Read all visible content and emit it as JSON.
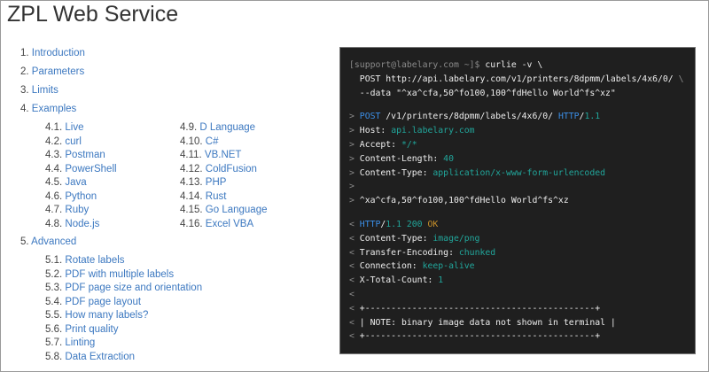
{
  "title": "ZPL Web Service",
  "toc": [
    {
      "num": "1.",
      "label": "Introduction"
    },
    {
      "num": "2.",
      "label": "Parameters"
    },
    {
      "num": "3.",
      "label": "Limits"
    },
    {
      "num": "4.",
      "label": "Examples"
    },
    {
      "num": "5.",
      "label": "Advanced"
    }
  ],
  "examples_col1": [
    {
      "num": "4.1.",
      "label": "Live"
    },
    {
      "num": "4.2.",
      "label": "curl"
    },
    {
      "num": "4.3.",
      "label": "Postman"
    },
    {
      "num": "4.4.",
      "label": "PowerShell"
    },
    {
      "num": "4.5.",
      "label": "Java"
    },
    {
      "num": "4.6.",
      "label": "Python"
    },
    {
      "num": "4.7.",
      "label": "Ruby"
    },
    {
      "num": "4.8.",
      "label": "Node.js"
    }
  ],
  "examples_col2": [
    {
      "num": "4.9.",
      "label": "D Language"
    },
    {
      "num": "4.10.",
      "label": "C#"
    },
    {
      "num": "4.11.",
      "label": "VB.NET"
    },
    {
      "num": "4.12.",
      "label": "ColdFusion"
    },
    {
      "num": "4.13.",
      "label": "PHP"
    },
    {
      "num": "4.14.",
      "label": "Rust"
    },
    {
      "num": "4.15.",
      "label": "Go Language"
    },
    {
      "num": "4.16.",
      "label": "Excel VBA"
    }
  ],
  "advanced": [
    {
      "num": "5.1.",
      "label": "Rotate labels"
    },
    {
      "num": "5.2.",
      "label": "PDF with multiple labels"
    },
    {
      "num": "5.3.",
      "label": "PDF page size and orientation"
    },
    {
      "num": "5.4.",
      "label": "PDF page layout"
    },
    {
      "num": "5.5.",
      "label": "How many labels?"
    },
    {
      "num": "5.6.",
      "label": "Print quality"
    },
    {
      "num": "5.7.",
      "label": "Linting"
    },
    {
      "num": "5.8.",
      "label": "Data Extraction"
    }
  ],
  "colors": {
    "link": "#3c78c0",
    "terminal_bg": "#1f1f1f",
    "keyword": "#3b8fe8",
    "value": "#21a69b",
    "status": "#c8902a"
  },
  "terminal": {
    "blocks": [
      [
        [
          [
            "[support@labelary.com ~]$ ",
            "g"
          ],
          [
            "curlie -v \\",
            "w"
          ]
        ],
        [
          [
            "  POST http://api.labelary.com/v1/printers/8dpmm/labels/4x6/0/ ",
            "w"
          ],
          [
            "\\",
            "g"
          ]
        ],
        [
          [
            "  --data \"^xa^cfa,50^fo100,100^fdHello World^fs^xz\"",
            "w"
          ]
        ]
      ],
      [
        [
          [
            "> ",
            "g"
          ],
          [
            "POST",
            "b"
          ],
          [
            " /v1/printers/8dpmm/labels/4x6/0/ ",
            "w"
          ],
          [
            "HTTP",
            "b"
          ],
          [
            "/",
            "w"
          ],
          [
            "1.1",
            "t"
          ]
        ],
        [
          [
            "> ",
            "g"
          ],
          [
            "Host: ",
            "w"
          ],
          [
            "api.labelary.com",
            "t"
          ]
        ],
        [
          [
            "> ",
            "g"
          ],
          [
            "Accept: ",
            "w"
          ],
          [
            "*/*",
            "t"
          ]
        ],
        [
          [
            "> ",
            "g"
          ],
          [
            "Content-Length: ",
            "w"
          ],
          [
            "40",
            "t"
          ]
        ],
        [
          [
            "> ",
            "g"
          ],
          [
            "Content-Type: ",
            "w"
          ],
          [
            "application/x-www-form-urlencoded",
            "t"
          ]
        ],
        [
          [
            ">",
            "g"
          ]
        ],
        [
          [
            "> ",
            "g"
          ],
          [
            "^xa^cfa,50^fo100,100^fdHello World^fs^xz",
            "w"
          ]
        ]
      ],
      [
        [
          [
            "< ",
            "g"
          ],
          [
            "HTTP",
            "b"
          ],
          [
            "/",
            "w"
          ],
          [
            "1.1 200 ",
            "t"
          ],
          [
            "OK",
            "o"
          ]
        ],
        [
          [
            "< ",
            "g"
          ],
          [
            "Content-Type: ",
            "w"
          ],
          [
            "image/png",
            "t"
          ]
        ],
        [
          [
            "< ",
            "g"
          ],
          [
            "Transfer-Encoding: ",
            "w"
          ],
          [
            "chunked",
            "t"
          ]
        ],
        [
          [
            "< ",
            "g"
          ],
          [
            "Connection: ",
            "w"
          ],
          [
            "keep-alive",
            "t"
          ]
        ],
        [
          [
            "< ",
            "g"
          ],
          [
            "X-Total-Count: ",
            "w"
          ],
          [
            "1",
            "t"
          ]
        ],
        [
          [
            "<",
            "g"
          ]
        ],
        [
          [
            "< ",
            "g"
          ],
          [
            "+--------------------------------------------+",
            "w"
          ]
        ],
        [
          [
            "< ",
            "g"
          ],
          [
            "| NOTE: binary image data not shown in terminal |",
            "w"
          ]
        ],
        [
          [
            "< ",
            "g"
          ],
          [
            "+--------------------------------------------+",
            "w"
          ]
        ]
      ]
    ]
  }
}
